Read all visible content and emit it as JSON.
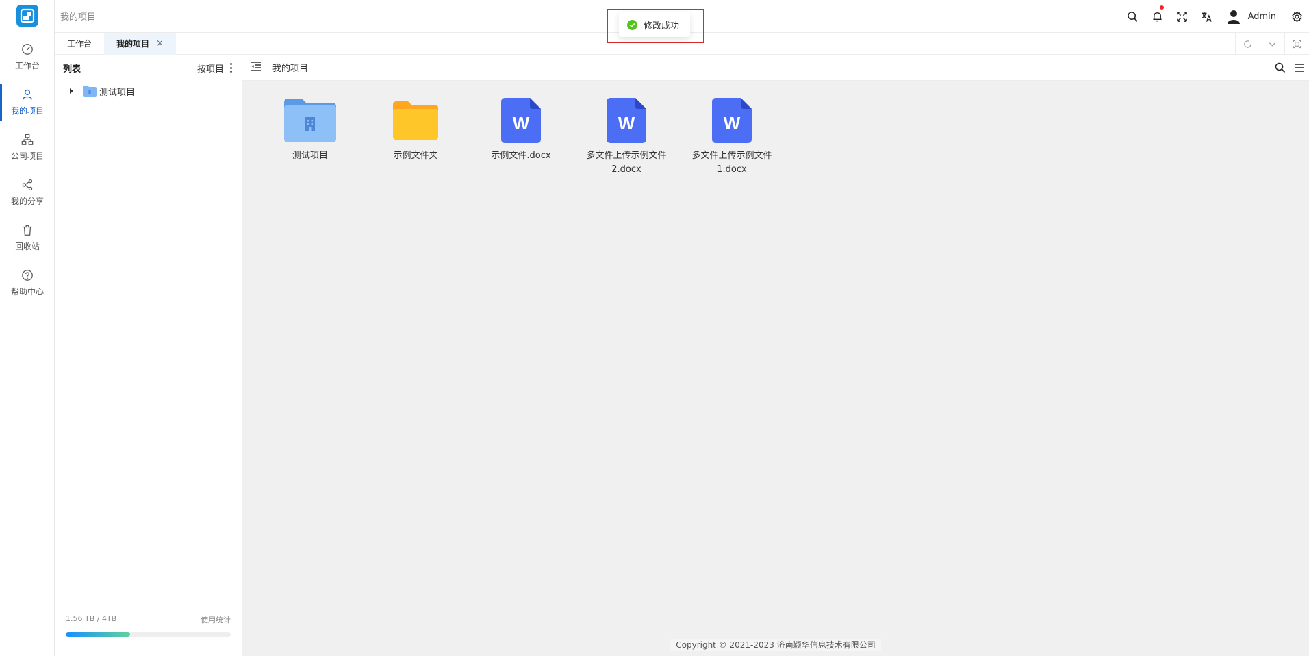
{
  "header": {
    "breadcrumb": "我的项目",
    "username": "Admin"
  },
  "rail": {
    "items": [
      {
        "label": "工作台",
        "icon": "dashboard-icon"
      },
      {
        "label": "我的项目",
        "icon": "user-icon",
        "active": true
      },
      {
        "label": "公司项目",
        "icon": "org-chart-icon"
      },
      {
        "label": "我的分享",
        "icon": "share-icon"
      },
      {
        "label": "回收站",
        "icon": "trash-icon"
      },
      {
        "label": "帮助中心",
        "icon": "help-icon"
      }
    ]
  },
  "tabs": [
    {
      "label": "工作台"
    },
    {
      "label": "我的项目",
      "closable": "×"
    }
  ],
  "panel": {
    "title": "列表",
    "sort_label": "按项目",
    "tree": [
      {
        "label": "测试项目"
      }
    ],
    "storage_usage": "1.56 TB / 4TB",
    "storage_link": "使用统计",
    "storage_fraction": 0.39
  },
  "main": {
    "title": "我的项目",
    "files": [
      {
        "name": "测试项目",
        "type": "project-folder"
      },
      {
        "name": "示例文件夹",
        "type": "folder"
      },
      {
        "name": "示例文件.docx",
        "type": "word"
      },
      {
        "name": "多文件上传示例文件2.docx",
        "type": "word"
      },
      {
        "name": "多文件上传示例文件1.docx",
        "type": "word"
      }
    ],
    "copyright": "Copyright © 2021-2023 济南颖华信息技术有限公司"
  },
  "toast": {
    "message": "修改成功"
  },
  "colors": {
    "accent": "#1a64c8",
    "word": "#4b6ef5",
    "folder": "#ffc629",
    "project_folder": "#7fb6f5",
    "success": "#52c41a"
  }
}
